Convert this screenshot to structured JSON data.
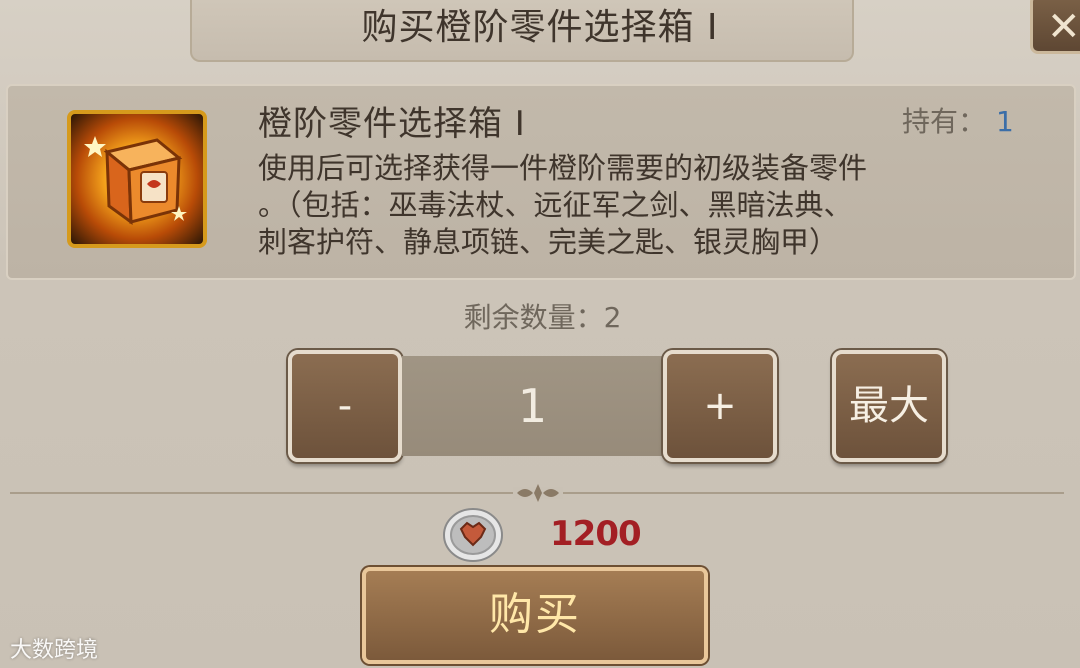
{
  "dialog": {
    "title": "购买橙阶零件选择箱 Ⅰ",
    "close_symbol": "✕"
  },
  "item": {
    "name": "橙阶零件选择箱 Ⅰ",
    "icon": "orange-part-chest-icon",
    "hold_label": "持有：",
    "hold_value": "1",
    "description_lines": [
      "使用后可选择获得一件橙阶需要的初级装备零件",
      "。（包括：巫毒法杖、远征军之剑、黑暗法典、",
      "刺客护符、静息项链、完美之匙、银灵胸甲）"
    ]
  },
  "purchase": {
    "remaining_label": "剩余数量：",
    "remaining_value": "2",
    "minus_label": "-",
    "quantity": "1",
    "plus_label": "+",
    "max_label": "最大",
    "currency_icon": "guild-coin-icon",
    "price": "1200",
    "buy_label": "购买"
  },
  "watermark": "大数跨境",
  "colors": {
    "price": "#a31f24",
    "hold_value": "#3b6ea8",
    "buy_text": "#ffe7a8"
  }
}
